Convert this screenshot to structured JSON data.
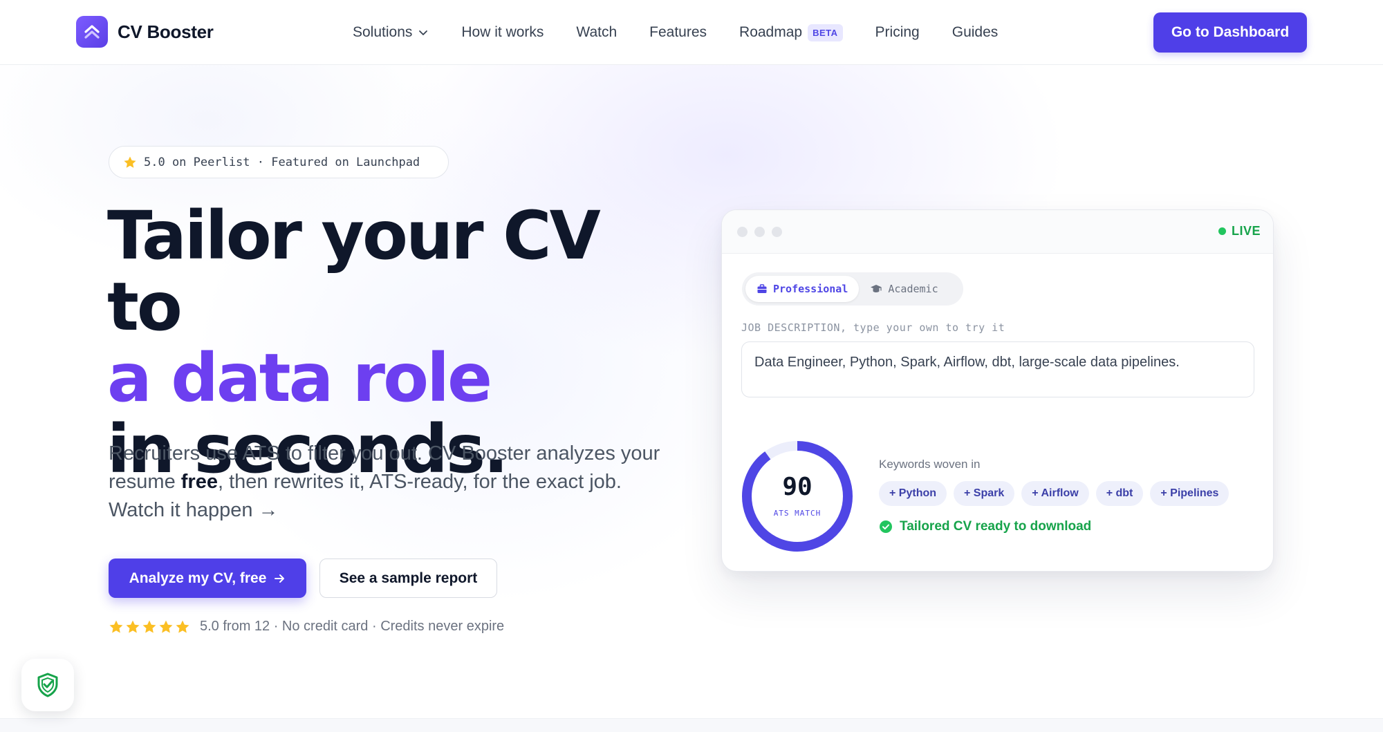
{
  "brand": {
    "name": "CV Booster",
    "accent": "#4f3fe8",
    "headline_accent": "#6d3ff0"
  },
  "nav": {
    "items": [
      {
        "label": "Solutions",
        "has_dropdown": true
      },
      {
        "label": "How it works"
      },
      {
        "label": "Watch"
      },
      {
        "label": "Features"
      },
      {
        "label": "Roadmap",
        "badge": "BETA"
      },
      {
        "label": "Pricing"
      },
      {
        "label": "Guides"
      }
    ],
    "cta": "Go to Dashboard"
  },
  "hero": {
    "pill_text": "5.0 on Peerlist · Featured on Launchpad",
    "headline_line1": "Tailor your CV to",
    "headline_line2": "a data role",
    "headline_line3": "in seconds.",
    "sub_part1": "Recruiters use ATS to filter you out. CV Booster analyzes your resume ",
    "sub_bold": "free",
    "sub_part2": ", then rewrites it, ATS-ready, for the exact job. Watch it happen →",
    "primary_button": "Analyze my CV, free",
    "secondary_button": "See a sample report",
    "rating_stars": 5,
    "rating_text": "5.0 from 12 · No credit card · Credits never expire"
  },
  "demo": {
    "live_label": "LIVE",
    "tabs": [
      {
        "label": "Professional",
        "active": true,
        "icon": "briefcase-icon"
      },
      {
        "label": "Academic",
        "active": false,
        "icon": "graduation-cap-icon"
      }
    ],
    "jd_label": "JOB DESCRIPTION, type your own to try it",
    "jd_text": "Data Engineer, Python, Spark, Airflow, dbt, large-scale data pipelines.",
    "score": "90",
    "score_label": "ATS MATCH",
    "score_fraction": 0.9,
    "keywords_title": "Keywords woven in",
    "keywords": [
      "+ Python",
      "+ Spark",
      "+ Airflow",
      "+ dbt",
      "+ Pipelines"
    ],
    "ready_text": "Tailored CV ready to download",
    "ready_color": "#16a34a"
  }
}
